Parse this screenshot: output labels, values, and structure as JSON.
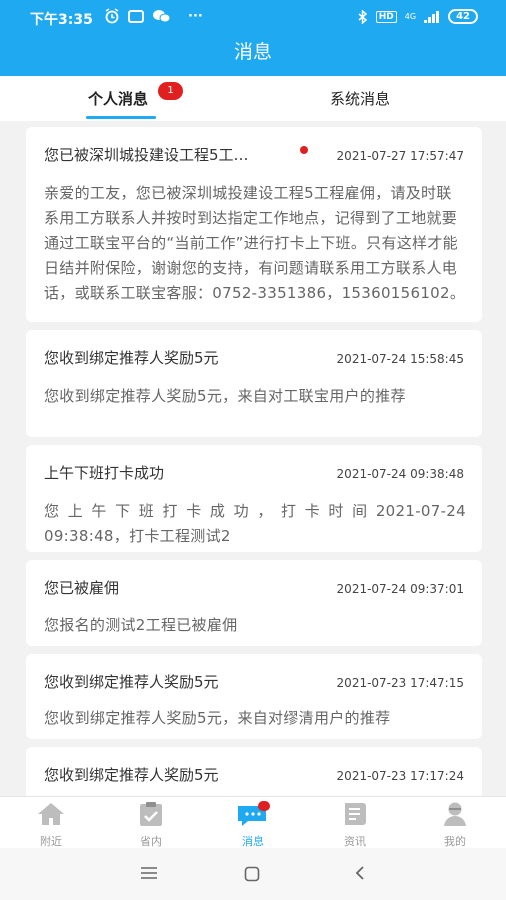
{
  "status_bar": {
    "time": "下午3:35",
    "icons": [
      "alarm-icon",
      "message-icon",
      "wechat-icon",
      "more-icon"
    ],
    "more": "···",
    "hd": "HD",
    "signal": "4G",
    "battery": "42"
  },
  "header": {
    "title": "消息"
  },
  "tabs": [
    {
      "label": "个人消息",
      "badge": "1",
      "active": true
    },
    {
      "label": "系统消息",
      "active": false
    }
  ],
  "messages": [
    {
      "title": "您已被深圳城投建设工程5工…",
      "time": "2021-07-27 17:57:47",
      "unread": true,
      "body": "亲爱的工友，您已被深圳城投建设工程5工程雇佣，请及时联系用工方联系人并按时到达指定工作地点，记得到了工地就要通过工联宝平台的“当前工作”进行打卡上下班。只有这样才能日结并附保险，谢谢您的支持，有问题请联系用工方联系人电话，或联系工联宝客服：0752-3351386，15360156102。"
    },
    {
      "title": "您收到绑定推荐人奖励5元",
      "time": "2021-07-24 15:58:45",
      "unread": false,
      "body": "您收到绑定推荐人奖励5元，来自对工联宝用户的推荐"
    },
    {
      "title": "上午下班打卡成功",
      "time": "2021-07-24 09:38:48",
      "unread": false,
      "body_line1": "您上午下班打卡成功，打卡时间2021-07-24",
      "body_line2": "09:38:48，打卡工程测试2"
    },
    {
      "title": "您已被雇佣",
      "time": "2021-07-24 09:37:01",
      "unread": false,
      "body": "您报名的测试2工程已被雇佣"
    },
    {
      "title": "您收到绑定推荐人奖励5元",
      "time": "2021-07-23 17:47:15",
      "unread": false,
      "body": "您收到绑定推荐人奖励5元，来自对缪清用户的推荐"
    },
    {
      "title": "您收到绑定推荐人奖励5元",
      "time": "2021-07-23 17:17:24",
      "unread": false
    }
  ],
  "bottom_nav": [
    {
      "label": "附近",
      "icon": "home-icon",
      "active": false
    },
    {
      "label": "省内",
      "icon": "clipboard-check-icon",
      "active": false
    },
    {
      "label": "消息",
      "icon": "chat-icon",
      "active": true
    },
    {
      "label": "资讯",
      "icon": "news-icon",
      "active": false
    },
    {
      "label": "我的",
      "icon": "user-icon",
      "active": false
    }
  ],
  "colors": {
    "primary": "#1fa9f1",
    "badge": "#e02020",
    "inactive": "#999999"
  }
}
